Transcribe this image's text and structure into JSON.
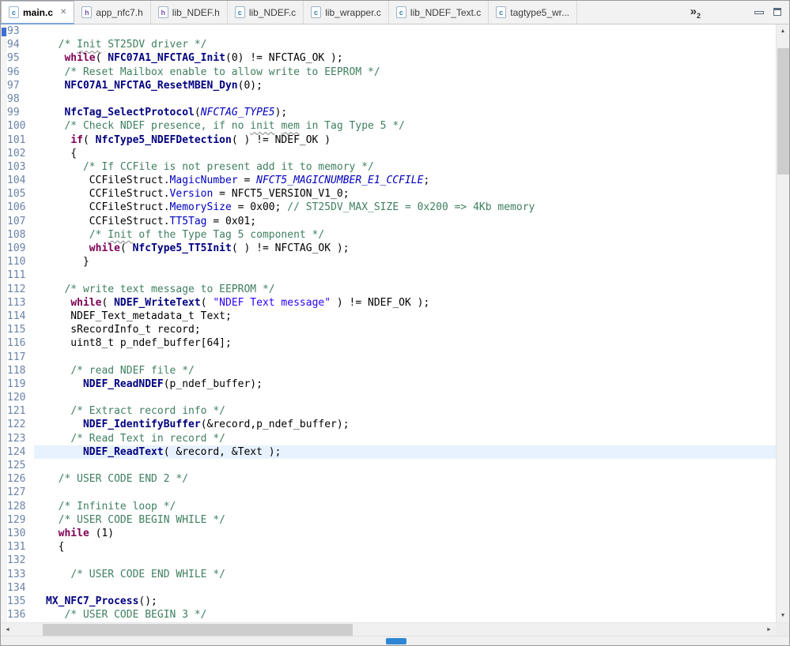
{
  "colors": {
    "comment": "#3F7F5F",
    "keyword": "#7F0055",
    "function": "#000080",
    "field": "#0000C0",
    "enumerator": "#0000C0",
    "string": "#2A00FF",
    "plain": "#000000",
    "line_number": "#6A82A8",
    "current_line_bg": "#E8F2FE",
    "active_tab_accent": "#7AA5D8",
    "annotation_marker": "#3F6FD1",
    "bottom_indicator": "#2F86D4"
  },
  "icons": {
    "scroll_up": "▲",
    "scroll_down": "▼",
    "scroll_left": "◄",
    "scroll_right": "►",
    "tab_close": "✕"
  },
  "tabs": {
    "overflow": {
      "glyph": "»",
      "count": "2"
    },
    "items": [
      {
        "label": "main.c",
        "file_type": "c",
        "active": true
      },
      {
        "label": "app_nfc7.h",
        "file_type": "h",
        "active": false
      },
      {
        "label": "lib_NDEF.h",
        "file_type": "h",
        "active": false
      },
      {
        "label": "lib_NDEF.c",
        "file_type": "c",
        "active": false
      },
      {
        "label": "lib_wrapper.c",
        "file_type": "c",
        "active": false
      },
      {
        "label": "lib_NDEF_Text.c",
        "file_type": "c",
        "active": false
      },
      {
        "label": "tagtype5_wr...",
        "file_type": "c",
        "active": false
      }
    ]
  },
  "editor": {
    "current_line": 124,
    "token_styles": {
      "p": "plain",
      "c": "comment",
      "cw": "comment-misspelled-word",
      "k": "keyword",
      "f": "function",
      "fl": "field",
      "en": "enumerator",
      "st": "string"
    },
    "lines": [
      {
        "n": 93,
        "t": []
      },
      {
        "n": 94,
        "t": [
          [
            "p",
            "  "
          ],
          [
            "c",
            "/* "
          ],
          [
            "cw",
            "Init"
          ],
          [
            "c",
            " ST25DV driver */"
          ]
        ]
      },
      {
        "n": 95,
        "t": [
          [
            "p",
            "   "
          ],
          [
            "k",
            "while"
          ],
          [
            "p",
            "( "
          ],
          [
            "f",
            "NFC07A1_NFCTAG_Init"
          ],
          [
            "p",
            "(0) != NFCTAG_OK );"
          ]
        ]
      },
      {
        "n": 96,
        "t": [
          [
            "p",
            "   "
          ],
          [
            "c",
            "/* Reset Mailbox enable to allow write to EEPROM */"
          ]
        ]
      },
      {
        "n": 97,
        "t": [
          [
            "p",
            "   "
          ],
          [
            "f",
            "NFC07A1_NFCTAG_ResetMBEN_Dyn"
          ],
          [
            "p",
            "(0);"
          ]
        ]
      },
      {
        "n": 98,
        "t": []
      },
      {
        "n": 99,
        "t": [
          [
            "p",
            "   "
          ],
          [
            "f",
            "NfcTag_SelectProtocol"
          ],
          [
            "p",
            "("
          ],
          [
            "en",
            "NFCTAG_TYPE5"
          ],
          [
            "p",
            ");"
          ]
        ]
      },
      {
        "n": 100,
        "t": [
          [
            "p",
            "   "
          ],
          [
            "c",
            "/* Check NDEF presence, if no "
          ],
          [
            "cw",
            "init"
          ],
          [
            "c",
            " "
          ],
          [
            "cw",
            "mem"
          ],
          [
            "c",
            " in Tag Type 5 */"
          ]
        ]
      },
      {
        "n": 101,
        "t": [
          [
            "p",
            "    "
          ],
          [
            "k",
            "if"
          ],
          [
            "p",
            "( "
          ],
          [
            "f",
            "NfcType5_NDEFDetection"
          ],
          [
            "p",
            "( ) != NDEF_OK )"
          ]
        ]
      },
      {
        "n": 102,
        "t": [
          [
            "p",
            "    {"
          ]
        ]
      },
      {
        "n": 103,
        "t": [
          [
            "p",
            "      "
          ],
          [
            "c",
            "/* If CCFile is not present add it to memory */"
          ]
        ]
      },
      {
        "n": 104,
        "t": [
          [
            "p",
            "       CCFileStruct."
          ],
          [
            "fl",
            "MagicNumber"
          ],
          [
            "p",
            " = "
          ],
          [
            "en",
            "NFCT5_MAGICNUMBER_E1_CCFILE"
          ],
          [
            "p",
            ";"
          ]
        ]
      },
      {
        "n": 105,
        "t": [
          [
            "p",
            "       CCFileStruct."
          ],
          [
            "fl",
            "Version"
          ],
          [
            "p",
            " = NFCT5_VERSION_V1_0;"
          ]
        ]
      },
      {
        "n": 106,
        "t": [
          [
            "p",
            "       CCFileStruct."
          ],
          [
            "fl",
            "MemorySize"
          ],
          [
            "p",
            " = 0x00; "
          ],
          [
            "c",
            "// ST25DV_MAX_SIZE = 0x200 => 4Kb memory"
          ]
        ]
      },
      {
        "n": 107,
        "t": [
          [
            "p",
            "       CCFileStruct."
          ],
          [
            "fl",
            "TT5Tag"
          ],
          [
            "p",
            " = 0x01;"
          ]
        ]
      },
      {
        "n": 108,
        "t": [
          [
            "p",
            "       "
          ],
          [
            "c",
            "/* "
          ],
          [
            "cw",
            "Init"
          ],
          [
            "c",
            " of the Type Tag 5 component */"
          ]
        ]
      },
      {
        "n": 109,
        "t": [
          [
            "p",
            "       "
          ],
          [
            "k",
            "while"
          ],
          [
            "p",
            "( "
          ],
          [
            "f",
            "NfcType5_TT5Init"
          ],
          [
            "p",
            "( ) != NFCTAG_OK );"
          ]
        ]
      },
      {
        "n": 110,
        "t": [
          [
            "p",
            "      }"
          ]
        ]
      },
      {
        "n": 111,
        "t": []
      },
      {
        "n": 112,
        "t": [
          [
            "p",
            "   "
          ],
          [
            "c",
            "/* write text message to EEPROM */"
          ]
        ]
      },
      {
        "n": 113,
        "t": [
          [
            "p",
            "    "
          ],
          [
            "k",
            "while"
          ],
          [
            "p",
            "( "
          ],
          [
            "f",
            "NDEF_WriteText"
          ],
          [
            "p",
            "( "
          ],
          [
            "st",
            "\"NDEF Text message\""
          ],
          [
            "p",
            " ) != NDEF_OK );"
          ]
        ]
      },
      {
        "n": 114,
        "t": [
          [
            "p",
            "    NDEF_Text_metadata_t Text;"
          ]
        ]
      },
      {
        "n": 115,
        "t": [
          [
            "p",
            "    sRecordInfo_t record;"
          ]
        ]
      },
      {
        "n": 116,
        "t": [
          [
            "p",
            "    uint8_t p_ndef_buffer[64];"
          ]
        ]
      },
      {
        "n": 117,
        "t": []
      },
      {
        "n": 118,
        "t": [
          [
            "p",
            "    "
          ],
          [
            "c",
            "/* read NDEF file */"
          ]
        ]
      },
      {
        "n": 119,
        "t": [
          [
            "p",
            "      "
          ],
          [
            "f",
            "NDEF_ReadNDEF"
          ],
          [
            "p",
            "(p_ndef_buffer);"
          ]
        ]
      },
      {
        "n": 120,
        "t": []
      },
      {
        "n": 121,
        "t": [
          [
            "p",
            "    "
          ],
          [
            "c",
            "/* Extract record info */"
          ]
        ]
      },
      {
        "n": 122,
        "t": [
          [
            "p",
            "      "
          ],
          [
            "f",
            "NDEF_IdentifyBuffer"
          ],
          [
            "p",
            "(&record,p_ndef_buffer);"
          ]
        ]
      },
      {
        "n": 123,
        "t": [
          [
            "p",
            "    "
          ],
          [
            "c",
            "/* Read Text in record */"
          ]
        ]
      },
      {
        "n": 124,
        "t": [
          [
            "p",
            "      "
          ],
          [
            "f",
            "NDEF_ReadText"
          ],
          [
            "p",
            "( &record, &Text );"
          ]
        ]
      },
      {
        "n": 125,
        "t": []
      },
      {
        "n": 126,
        "t": [
          [
            "p",
            "  "
          ],
          [
            "c",
            "/* USER CODE END 2 */"
          ]
        ]
      },
      {
        "n": 127,
        "t": []
      },
      {
        "n": 128,
        "t": [
          [
            "p",
            "  "
          ],
          [
            "c",
            "/* Infinite loop */"
          ]
        ]
      },
      {
        "n": 129,
        "t": [
          [
            "p",
            "  "
          ],
          [
            "c",
            "/* USER CODE BEGIN WHILE */"
          ]
        ]
      },
      {
        "n": 130,
        "t": [
          [
            "p",
            "  "
          ],
          [
            "k",
            "while"
          ],
          [
            "p",
            " (1)"
          ]
        ]
      },
      {
        "n": 131,
        "t": [
          [
            "p",
            "  {"
          ]
        ]
      },
      {
        "n": 132,
        "t": []
      },
      {
        "n": 133,
        "t": [
          [
            "p",
            "    "
          ],
          [
            "c",
            "/* USER CODE END WHILE */"
          ]
        ]
      },
      {
        "n": 134,
        "t": []
      },
      {
        "n": 135,
        "t": [
          [
            "f",
            "MX_NFC7_Process"
          ],
          [
            "p",
            "();"
          ]
        ]
      },
      {
        "n": 136,
        "t": [
          [
            "p",
            "   "
          ],
          [
            "c",
            "/* USER CODE BEGIN 3 */"
          ]
        ]
      }
    ]
  }
}
